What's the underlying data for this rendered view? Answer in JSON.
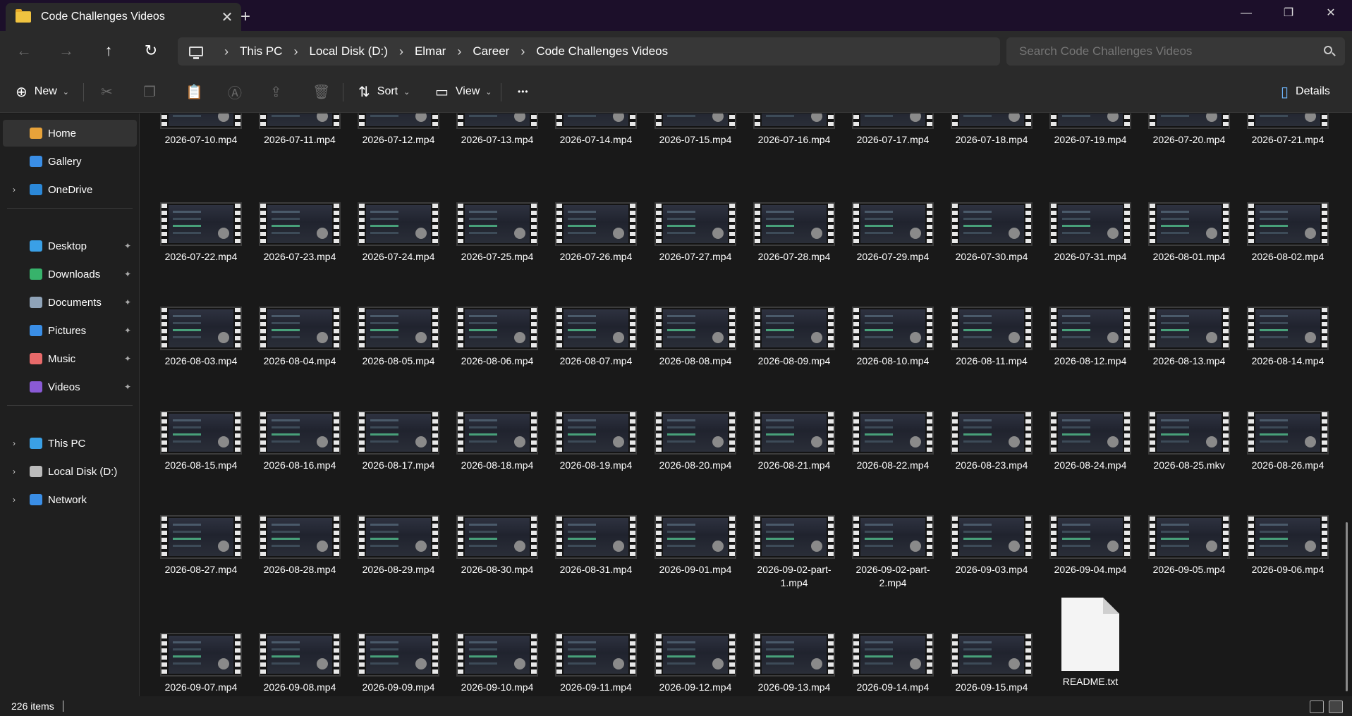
{
  "window": {
    "tab_title": "Code Challenges Videos",
    "tab_close_glyph": "✕",
    "new_tab_glyph": "+",
    "minimize_glyph": "—",
    "maximize_glyph": "❐",
    "close_glyph": "✕"
  },
  "nav": {
    "back_glyph": "←",
    "forward_glyph": "→",
    "up_glyph": "↑",
    "refresh_glyph": "↻"
  },
  "breadcrumb": [
    "This PC",
    "Local Disk (D:)",
    "Elmar",
    "Career",
    "Code Challenges Videos"
  ],
  "breadcrumb_sep": "›",
  "search": {
    "placeholder": "Search Code Challenges Videos"
  },
  "toolbar": {
    "new_label": "New",
    "sort_label": "Sort",
    "view_label": "View",
    "more_glyph": "•••",
    "details_label": "Details",
    "caret": "⌄"
  },
  "sidebar": {
    "quick": [
      {
        "label": "Home",
        "icon": "home-icon",
        "color": "#e8a33a"
      },
      {
        "label": "Gallery",
        "icon": "gallery-icon",
        "color": "#3a8ee6"
      },
      {
        "label": "OneDrive",
        "icon": "cloud-icon",
        "color": "#2b88d8"
      }
    ],
    "pinned": [
      {
        "label": "Desktop",
        "icon": "desktop-icon",
        "color": "#3aa0e6"
      },
      {
        "label": "Downloads",
        "icon": "download-icon",
        "color": "#37b36b"
      },
      {
        "label": "Documents",
        "icon": "documents-icon",
        "color": "#8fa3b8"
      },
      {
        "label": "Pictures",
        "icon": "pictures-icon",
        "color": "#3a8ee6"
      },
      {
        "label": "Music",
        "icon": "music-icon",
        "color": "#e86a6a"
      },
      {
        "label": "Videos",
        "icon": "videos-icon",
        "color": "#8a5ad6"
      }
    ],
    "devices": [
      {
        "label": "This PC",
        "icon": "pc-icon",
        "color": "#3aa0e6"
      },
      {
        "label": "Local Disk (D:)",
        "icon": "drive-icon",
        "color": "#bbbbbb"
      },
      {
        "label": "Network",
        "icon": "network-icon",
        "color": "#3a8ee6"
      }
    ],
    "chevron": "›",
    "pin": "📌"
  },
  "files": [
    [
      "2026-07-10.mp4",
      "2026-07-11.mp4",
      "2026-07-12.mp4",
      "2026-07-13.mp4",
      "2026-07-14.mp4",
      "2026-07-15.mp4",
      "2026-07-16.mp4",
      "2026-07-17.mp4",
      "2026-07-18.mp4",
      "2026-07-19.mp4",
      "2026-07-20.mp4",
      "2026-07-21.mp4"
    ],
    [
      "2026-07-22.mp4",
      "2026-07-23.mp4",
      "2026-07-24.mp4",
      "2026-07-25.mp4",
      "2026-07-26.mp4",
      "2026-07-27.mp4",
      "2026-07-28.mp4",
      "2026-07-29.mp4",
      "2026-07-30.mp4",
      "2026-07-31.mp4",
      "2026-08-01.mp4",
      "2026-08-02.mp4"
    ],
    [
      "2026-08-03.mp4",
      "2026-08-04.mp4",
      "2026-08-05.mp4",
      "2026-08-06.mp4",
      "2026-08-07.mp4",
      "2026-08-08.mp4",
      "2026-08-09.mp4",
      "2026-08-10.mp4",
      "2026-08-11.mp4",
      "2026-08-12.mp4",
      "2026-08-13.mp4",
      "2026-08-14.mp4"
    ],
    [
      "2026-08-15.mp4",
      "2026-08-16.mp4",
      "2026-08-17.mp4",
      "2026-08-18.mp4",
      "2026-08-19.mp4",
      "2026-08-20.mp4",
      "2026-08-21.mp4",
      "2026-08-22.mp4",
      "2026-08-23.mp4",
      "2026-08-24.mp4",
      "2026-08-25.mkv",
      "2026-08-26.mp4"
    ],
    [
      "2026-08-27.mp4",
      "2026-08-28.mp4",
      "2026-08-29.mp4",
      "2026-08-30.mp4",
      "2026-08-31.mp4",
      "2026-09-01.mp4",
      "2026-09-02-part-1.mp4",
      "2026-09-02-part-2.mp4",
      "2026-09-03.mp4",
      "2026-09-04.mp4",
      "2026-09-05.mp4",
      "2026-09-06.mp4"
    ],
    [
      "2026-09-07.mp4",
      "2026-09-08.mp4",
      "2026-09-09.mp4",
      "2026-09-10.mp4",
      "2026-09-11.mp4",
      "2026-09-12.mp4",
      "2026-09-13.mp4",
      "2026-09-14.mp4",
      "2026-09-15.mp4",
      "README.txt"
    ]
  ],
  "status": {
    "item_count": "226 items"
  }
}
